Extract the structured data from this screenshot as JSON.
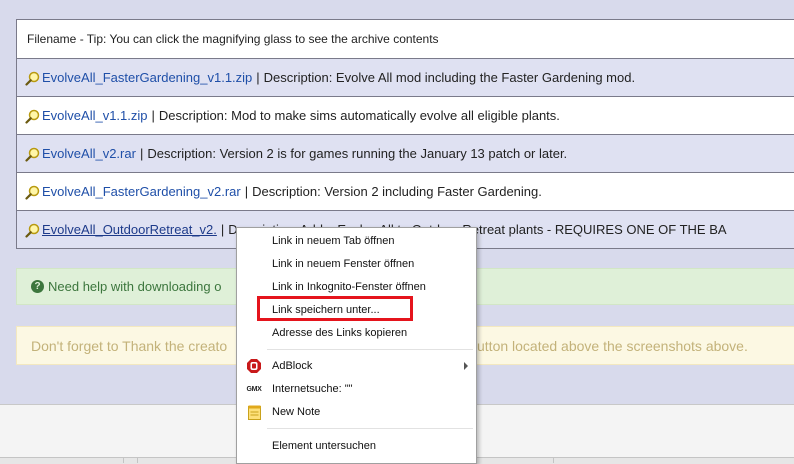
{
  "table": {
    "header": "Filename - Tip: You can click the magnifying glass to see the archive contents",
    "rows": [
      {
        "file": "EvolveAll_FasterGardening_v1.1.zip",
        "desc": "Description: Evolve All mod including the Faster Gardening mod."
      },
      {
        "file": "EvolveAll_v1.1.zip",
        "desc": "Description: Mod to make sims automatically evolve all eligible plants."
      },
      {
        "file": "EvolveAll_v2.rar",
        "desc": "Description: Version 2 is for games running the January 13 patch or later."
      },
      {
        "file": "EvolveAll_FasterGardening_v2.rar",
        "desc": "Description: Version 2 including Faster Gardening."
      },
      {
        "file": "EvolveAll_OutdoorRetreat_v2.",
        "desc": "Description: Add... Evolve All to Outdoor Retreat plants - REQUIRES ONE OF THE BA"
      }
    ],
    "separator": "|"
  },
  "notices": {
    "help": "Need help with downloading o",
    "thanks_left": "Don't forget to Thank the creato",
    "thanks_right": "utton located above the screenshots above."
  },
  "context_menu": {
    "items": {
      "open_new_tab": "Link in neuem Tab öffnen",
      "open_new_window": "Link in neuem Fenster öffnen",
      "open_incognito": "Link in Inkognito-Fenster öffnen",
      "save_link_as": "Link speichern unter...",
      "copy_link_address": "Adresse des Links kopieren",
      "adblock": "AdBlock",
      "internet_search": "Internetsuche: \"\"",
      "new_note": "New Note",
      "inspect_element": "Element untersuchen"
    },
    "icons": {
      "adblock": "adblock-stop-icon",
      "gmx": "GMX",
      "new_note": "note-icon"
    },
    "highlight_color": "#e5141c"
  },
  "colors": {
    "link": "#1f4fa8",
    "page_bg": "#d8daec",
    "help_bg": "#dff0d8",
    "thanks_bg": "#fcf8e3"
  }
}
